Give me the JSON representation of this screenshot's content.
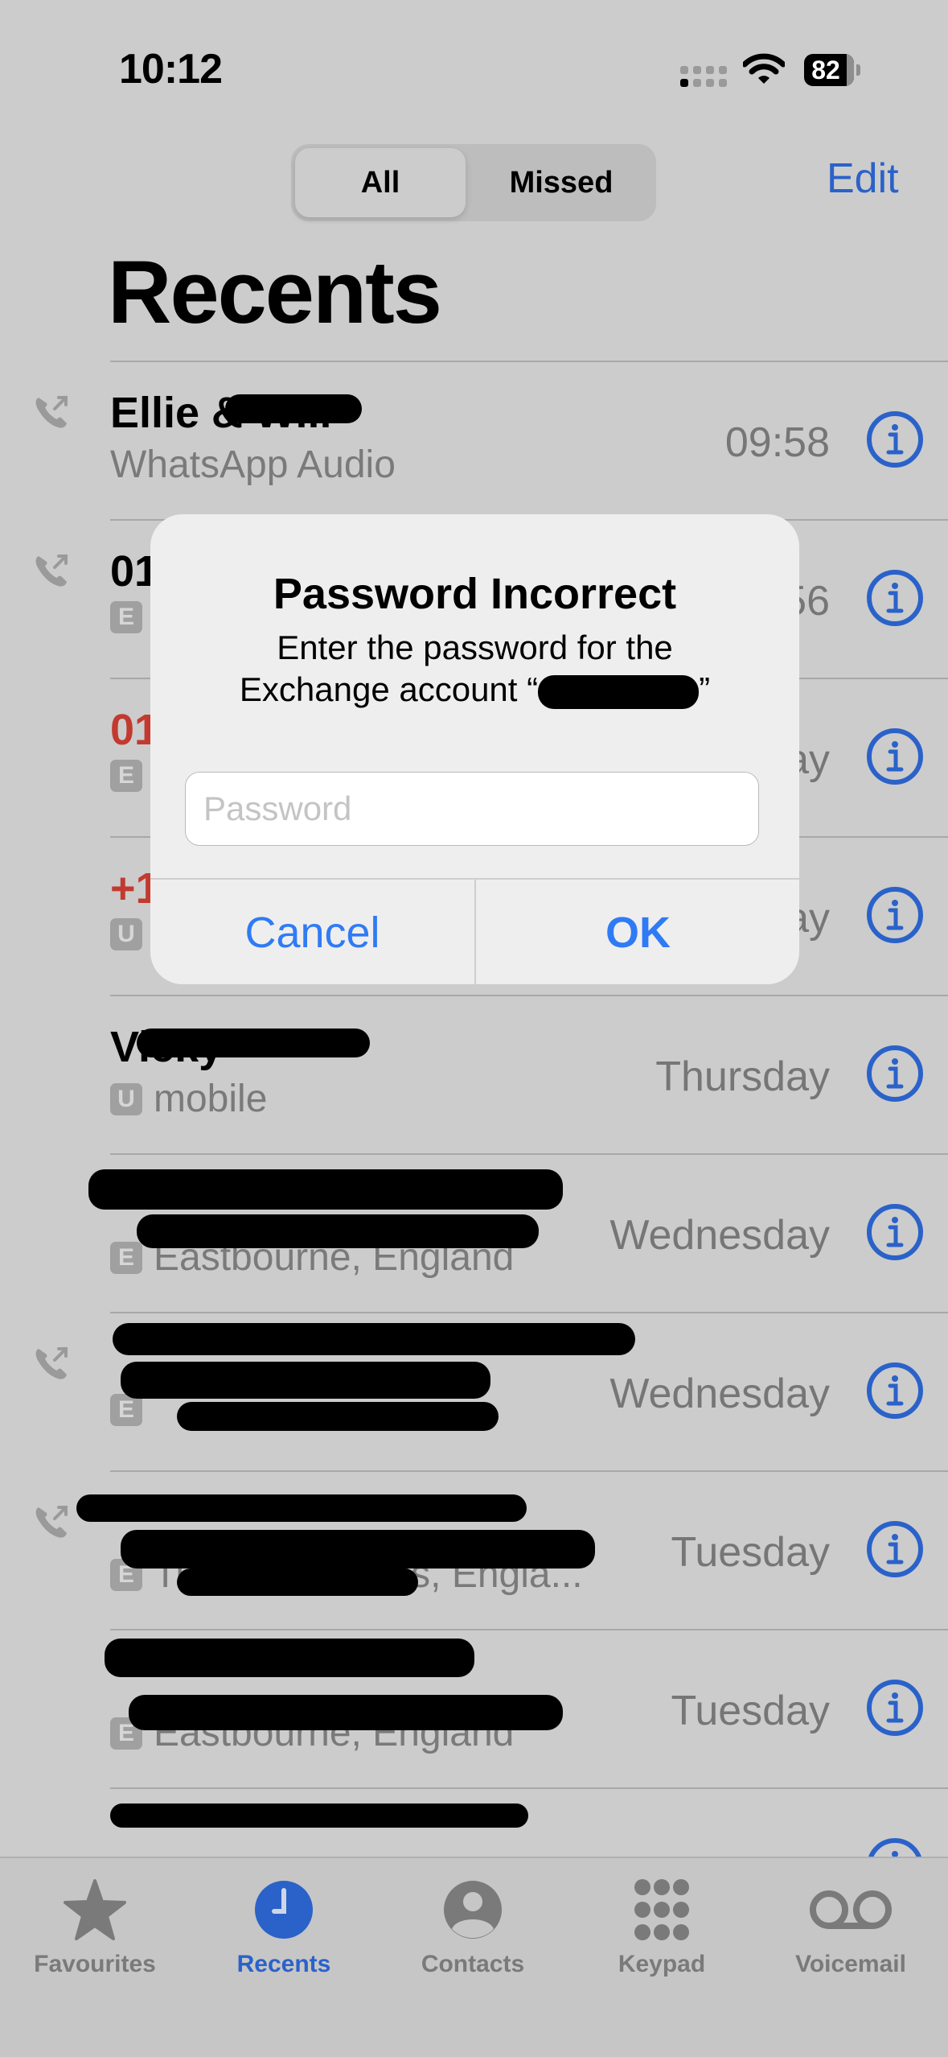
{
  "status_bar": {
    "time": "10:12",
    "battery": "82"
  },
  "header": {
    "segments": [
      {
        "label": "All",
        "selected": true
      },
      {
        "label": "Missed",
        "selected": false
      }
    ],
    "edit_label": "Edit",
    "title": "Recents"
  },
  "calls": [
    {
      "name": "Ellie & Will",
      "name_redacted": true,
      "subtitle": "WhatsApp Audio",
      "badge": "",
      "when": "09:58",
      "missed": false,
      "outgoing": true
    },
    {
      "name": "01",
      "name_redacted": false,
      "subtitle": "",
      "badge": "E",
      "when": "56",
      "missed": false,
      "outgoing": true
    },
    {
      "name": "01",
      "name_redacted": false,
      "subtitle": "",
      "badge": "E",
      "when": "ay",
      "missed": true,
      "outgoing": false
    },
    {
      "name": "+1",
      "name_redacted": false,
      "subtitle": "",
      "badge": "U",
      "when": "ay",
      "missed": true,
      "outgoing": false
    },
    {
      "name": "Vicky",
      "name_redacted": true,
      "subtitle": "mobile",
      "badge": "U",
      "when": "Thursday",
      "missed": false,
      "outgoing": false
    },
    {
      "name": "",
      "name_redacted": true,
      "subtitle": "Eastbourne, England",
      "badge": "E",
      "when": "Wednesday",
      "missed": false,
      "outgoing": false
    },
    {
      "name": "",
      "name_redacted": true,
      "subtitle": "",
      "badge": "E",
      "when": "Wednesday",
      "missed": false,
      "outgoing": true
    },
    {
      "name": "",
      "name_redacted": true,
      "subtitle": "Tunbridge Wells, Engla...",
      "badge": "E",
      "when": "Tuesday",
      "missed": false,
      "outgoing": true
    },
    {
      "name": "",
      "name_redacted": true,
      "subtitle": "Eastbourne, England",
      "badge": "E",
      "when": "Tuesday",
      "missed": false,
      "outgoing": false
    },
    {
      "name": "",
      "name_redacted": true,
      "subtitle": "",
      "badge": "",
      "when": "",
      "missed": false,
      "outgoing": false
    }
  ],
  "dialog": {
    "title": "Password Incorrect",
    "message_line1": "Enter the password for the",
    "message_line2_prefix": "Exchange account “",
    "message_line2_suffix": "”",
    "password_placeholder": "Password",
    "password_value": "",
    "cancel_label": "Cancel",
    "ok_label": "OK"
  },
  "tab_bar": {
    "tabs": [
      {
        "label": "Favourites",
        "icon": "star-icon",
        "active": false
      },
      {
        "label": "Recents",
        "icon": "clock-icon",
        "active": true
      },
      {
        "label": "Contacts",
        "icon": "person-circle-icon",
        "active": false
      },
      {
        "label": "Keypad",
        "icon": "keypad-icon",
        "active": false
      },
      {
        "label": "Voicemail",
        "icon": "voicemail-icon",
        "active": false
      }
    ]
  },
  "colors": {
    "accent": "#2a62c9",
    "dialog_button": "#2f7bf5",
    "missed": "#c23a2f",
    "background": "#cccccc"
  }
}
